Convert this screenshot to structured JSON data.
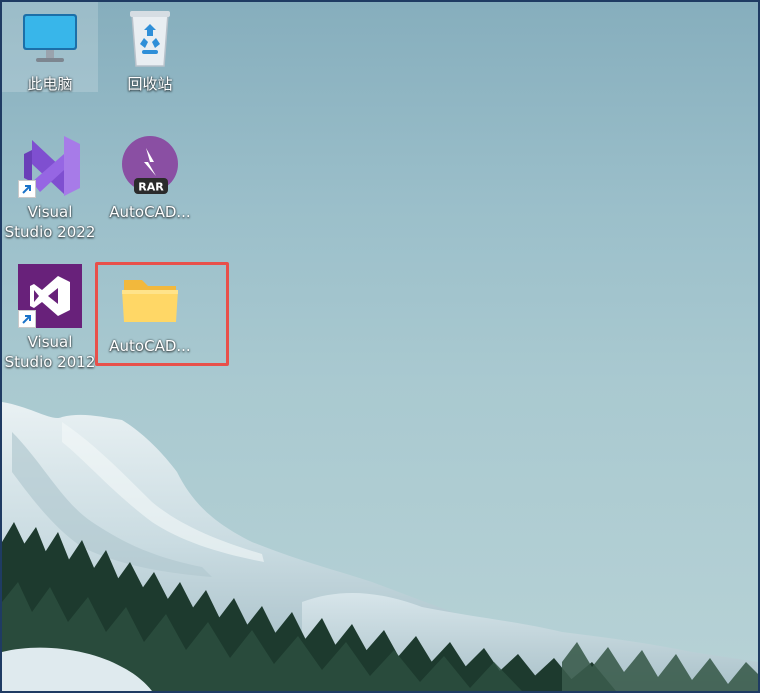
{
  "desktop": {
    "icons": [
      {
        "label": "此电脑",
        "icon": "this-pc-monitor-icon"
      },
      {
        "label": "回收站",
        "icon": "recycle-bin-icon"
      },
      {
        "label": "Visual\nStudio 2022",
        "icon": "visual-studio-2022-icon",
        "shortcut": true
      },
      {
        "label": "AutoCAD...",
        "icon": "winrar-archive-icon"
      },
      {
        "label": "Visual\nStudio 2012",
        "icon": "visual-studio-2012-icon",
        "shortcut": true
      },
      {
        "label": "AutoCAD...",
        "icon": "folder-icon"
      }
    ],
    "rar_badge_text": "RAR"
  },
  "highlight": {
    "color": "#e8504a",
    "target": "AutoCAD... folder"
  },
  "colors": {
    "sky": "#9bbfca",
    "vs2022_purple": "#8f5bd6",
    "vs2012_purple": "#68217a",
    "folder_yellow": "#ffd75e",
    "monitor_blue": "#2aa7e0"
  }
}
